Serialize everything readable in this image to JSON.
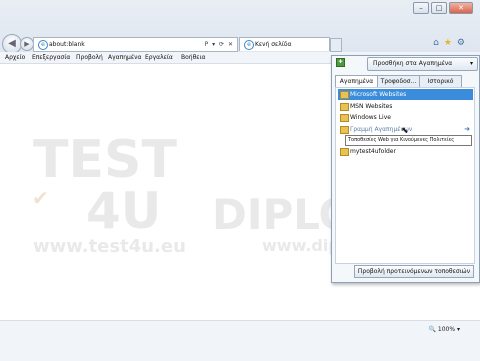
{
  "address": {
    "url": "about:blank",
    "icons": "P ▾ ⟳ ✕"
  },
  "tab": {
    "label": "Κενή σελίδα"
  },
  "menu": [
    "Αρχείο",
    "Επεξεργασία",
    "Προβολή",
    "Αγαπημένα",
    "Εργαλεία",
    "Βοήθεια"
  ],
  "favorites_panel": {
    "add_button": "Προσθήκη στα Αγαπημένα",
    "tabs": [
      "Αγαπημένα",
      "Τροφοδοσ...",
      "Ιστορικό"
    ],
    "items": [
      "Microsoft Websites",
      "MSN Websites",
      "Windows Live",
      "Γραμμή Αγαπημένων",
      "mytest4ufolder"
    ],
    "tooltip": "Τοποθεσίες Web για Κινούμενες Πολιτείες",
    "bottom_button": "Προβολή προτεινόμενων τοποθεσιών"
  },
  "watermark": {
    "brand1": "TEST",
    "brand2": "4U",
    "url1": "www.test4u.eu",
    "brand3": "DIPLOMA",
    "url2": "www.diploma.edu.gr"
  },
  "status": {
    "zoom": "100%"
  },
  "colors": {
    "selection": "#3b8ddb",
    "folder": "#e8c254"
  }
}
